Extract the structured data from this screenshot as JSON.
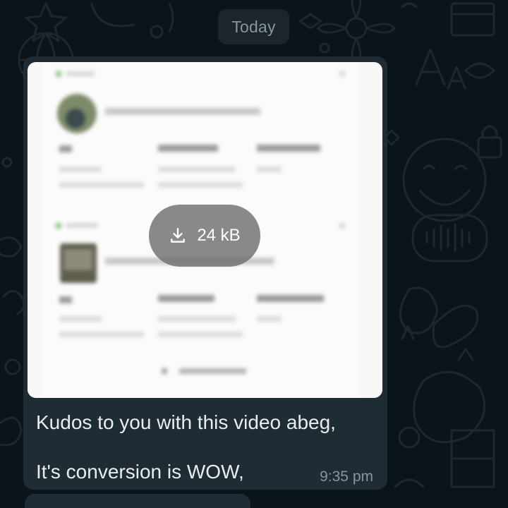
{
  "chat": {
    "date_separator": "Today"
  },
  "message": {
    "media": {
      "type": "image",
      "download_size": "24 kB",
      "download_icon": "download-icon"
    },
    "caption_line1": "Kudos to you with this video abeg,",
    "caption_line2": "It's conversion is WOW,",
    "time": "9:35 pm"
  },
  "colors": {
    "background": "#0b141a",
    "bubble": "#1f2c33",
    "text": "#e9edef",
    "meta": "#8696a0"
  }
}
